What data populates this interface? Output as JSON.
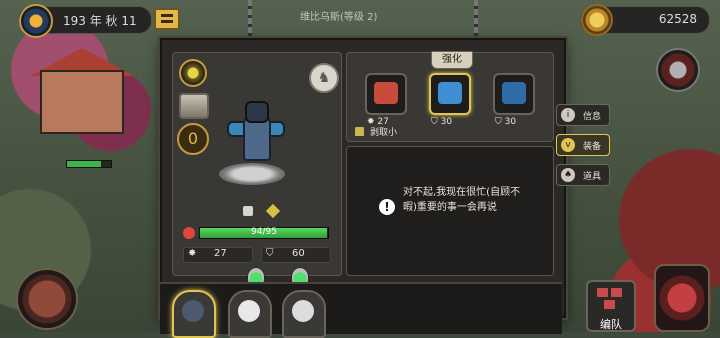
{
  "header": {
    "date": "193 年 秋 11",
    "location": "维比乌斯(等级 2)",
    "gold": "62528"
  },
  "unit": {
    "hp_text": "94/95",
    "hp_fraction": 0.989,
    "attack": "27",
    "defense": "60",
    "level_badge": "0"
  },
  "equipment": {
    "tab_label": "强化",
    "slots": [
      {
        "value": "27",
        "stat_icon": "attack-icon",
        "color": "#c94b3c"
      },
      {
        "value": "30",
        "stat_icon": "shield-icon",
        "color": "#3d8fd1"
      },
      {
        "value": "30",
        "stat_icon": "shield-icon",
        "color": "#2f6ca6"
      }
    ],
    "skill": "剥取小"
  },
  "message": "对不起,我现在很忙(自顾不暇)重要的事一会再说",
  "side_tabs": [
    {
      "label": "信息",
      "icon": "i"
    },
    {
      "label": "装备",
      "icon": "v"
    },
    {
      "label": "道具",
      "icon": "♠"
    }
  ],
  "squad_button": "编队",
  "colors": {
    "accent": "#e2c451",
    "hp": "#3fb34b",
    "panel": "#2b2926"
  }
}
